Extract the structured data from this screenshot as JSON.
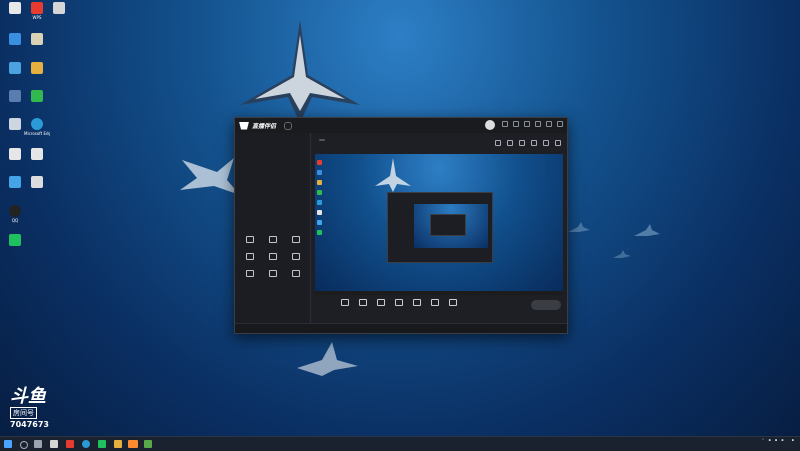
{
  "desktop": {
    "icons": [
      {
        "label": "",
        "color": "#e8e8e8"
      },
      {
        "label": "WPS",
        "color": "#e63b2e"
      },
      {
        "label": "",
        "color": "#d6d6d6"
      },
      {
        "label": "",
        "color": "#3b8fe0"
      },
      {
        "label": "",
        "color": "#d9d2b5"
      },
      {
        "label": "",
        "color": "#4aa3df"
      },
      {
        "label": "",
        "color": "#e5b040"
      },
      {
        "label": "",
        "color": "#5a7cae"
      },
      {
        "label": "",
        "color": "#31b84f"
      },
      {
        "label": "",
        "color": "#cdd6e0"
      },
      {
        "label": "Microsoft Edge",
        "color": "#2b9ad8"
      },
      {
        "label": "",
        "color": "#e6e6e6"
      },
      {
        "label": "",
        "color": "#e6e6e6"
      },
      {
        "label": "",
        "color": "#43a5e8"
      },
      {
        "label": "",
        "color": "#dddddd"
      },
      {
        "label": "QQ",
        "color": "#222222"
      },
      {
        "label": "",
        "color": "#1fc15e"
      }
    ]
  },
  "app": {
    "version_badge": "",
    "tabs": [
      "",
      "",
      ""
    ],
    "scene_item": "",
    "tools_title": "",
    "tools": [
      "",
      "",
      "",
      "",
      "",
      "",
      "",
      "",
      ""
    ],
    "header_title": "",
    "header_badge": "",
    "header_meta": [
      "",
      "",
      ""
    ],
    "bottom_tools": [
      "",
      "",
      "",
      "",
      "",
      "",
      ""
    ],
    "start_button": "",
    "status_text": "",
    "status_right": [
      "",
      "",
      ""
    ]
  },
  "watermark": {
    "brand": "斗鱼",
    "room_label": "房间号",
    "room_number": "7047673"
  },
  "taskbar": {
    "time": "",
    "date": ""
  }
}
